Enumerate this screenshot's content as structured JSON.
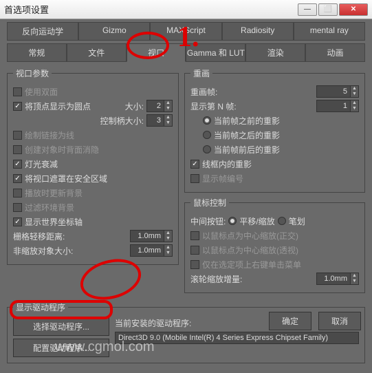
{
  "window": {
    "title": "首选项设置"
  },
  "tabs_row1": [
    "反向运动学",
    "Gizmo",
    "MAXScript",
    "Radiosity",
    "mental ray"
  ],
  "tabs_row2": [
    "常规",
    "文件",
    "视口",
    "Gamma 和 LUT",
    "渲染",
    "动画"
  ],
  "viewport_params": {
    "title": "视口参数",
    "use_dual": "使用双面",
    "vertex_as_dot": "将顶点显示为圆点",
    "size_label": "大小:",
    "size_value": "2",
    "handle_size_label": "控制柄大小:",
    "handle_size_value": "3",
    "draw_links": "绘制链接为线",
    "backface_cull": "创建对象时背面消隐",
    "light_atten": "灯光衰减",
    "safe_frame": "将视口遮罩在安全区域",
    "update_bg": "播放时更新背景",
    "filter_bg": "过滤环境背景",
    "world_axis": "显示世界坐标轴",
    "grid_dist_label": "栅格轻移距离:",
    "grid_dist_value": "1.0mm",
    "nonscale_label": "非缩放对象大小:",
    "nonscale_value": "1.0mm"
  },
  "redraw": {
    "title": "重画",
    "redraw_frames_label": "重画帧:",
    "redraw_frames_value": "5",
    "show_nth_label": "显示第 N 帧:",
    "show_nth_value": "1",
    "before": "当前帧之前的重影",
    "after": "当前帧之后的重影",
    "both": "当前帧前后的重影",
    "wireframe": "线框内的重影",
    "show_num": "显示帧编号"
  },
  "mouse": {
    "title": "鼠标控制",
    "middle_label": "中间按钮:",
    "pan": "平移/缩放",
    "stroke": "笔划",
    "ortho": "以鼠标点为中心缩放(正交)",
    "persp": "以鼠标点为中心缩放(透视)",
    "right_click": "仅在选定项上右键单击菜单",
    "wheel_label": "滚轮缩放增量:",
    "wheel_value": "1.0mm"
  },
  "driver": {
    "title": "显示驱动程序",
    "select_btn": "选择驱动程序...",
    "config_btn": "配置驱动程序...",
    "installed_label": "当前安装的驱动程序:",
    "driver_name": "Direct3D 9.0 (Mobile Intel(R) 4 Series Express Chipset Family)"
  },
  "buttons": {
    "ok": "确定",
    "cancel": "取消"
  },
  "watermark": "www.cgmol.com",
  "annotation_1": "1."
}
